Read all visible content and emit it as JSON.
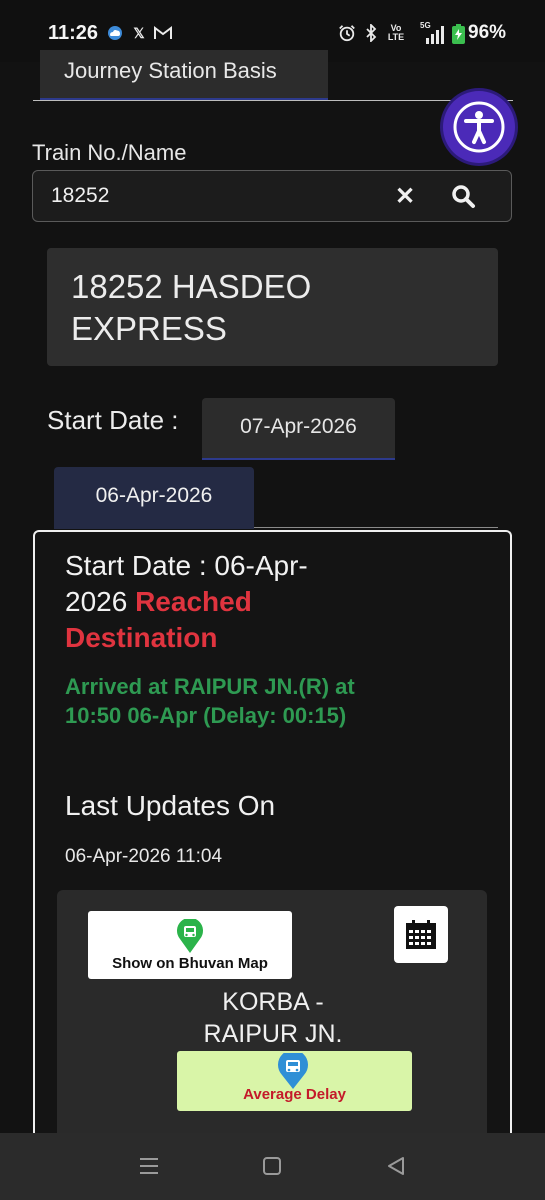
{
  "status_bar": {
    "time": "11:26",
    "battery": "96%",
    "network": "5G",
    "volte": "Vo LTE",
    "left_icons": [
      "cloud-icon",
      "x-icon",
      "gmail-icon"
    ],
    "right_icons": [
      "alarm-icon",
      "bluetooth-icon",
      "volte-icon",
      "signal-icon",
      "battery-icon"
    ]
  },
  "tabs": {
    "journey_station_basis": "Journey Station Basis"
  },
  "search": {
    "label": "Train No./Name",
    "value": "18252",
    "clear_icon": "close-icon",
    "search_icon": "search-icon"
  },
  "train": {
    "title": "18252 HASDEO EXPRESS"
  },
  "start_date": {
    "label": "Start Date :",
    "tabs": [
      {
        "label": "07-Apr-2026",
        "selected": false
      },
      {
        "label": "06-Apr-2026",
        "selected": true
      }
    ]
  },
  "running_status": {
    "start_date_text": "Start Date : 06-Apr-2026",
    "state": "Reached Destination",
    "arrival_text": "Arrived at RAIPUR JN.(R) at 10:50 06-Apr (Delay: 00:15)",
    "last_updates_label": "Last Updates On",
    "last_updates_time": "06-Apr-2026 11:04"
  },
  "actions": {
    "bhuvan_map": "Show on Bhuvan Map",
    "average_delay": "Average Delay",
    "calendar_icon": "calendar-icon"
  },
  "route": {
    "text": "KORBA - RAIPUR JN."
  },
  "colors": {
    "background": "#121212",
    "tab_accent": "#2d3a8c",
    "selected_tab": "#242a44",
    "reached_red": "#e0343f",
    "arrived_green": "#2e9a52",
    "accessibility_purple": "#4b2ab8",
    "avg_delay_bg": "#d9f5a8",
    "map_pin_green": "#2bb34a",
    "avg_pin_blue": "#2f8fd6"
  },
  "nav_bar": {
    "icons": [
      "menu-icon",
      "home-icon",
      "back-icon"
    ]
  }
}
